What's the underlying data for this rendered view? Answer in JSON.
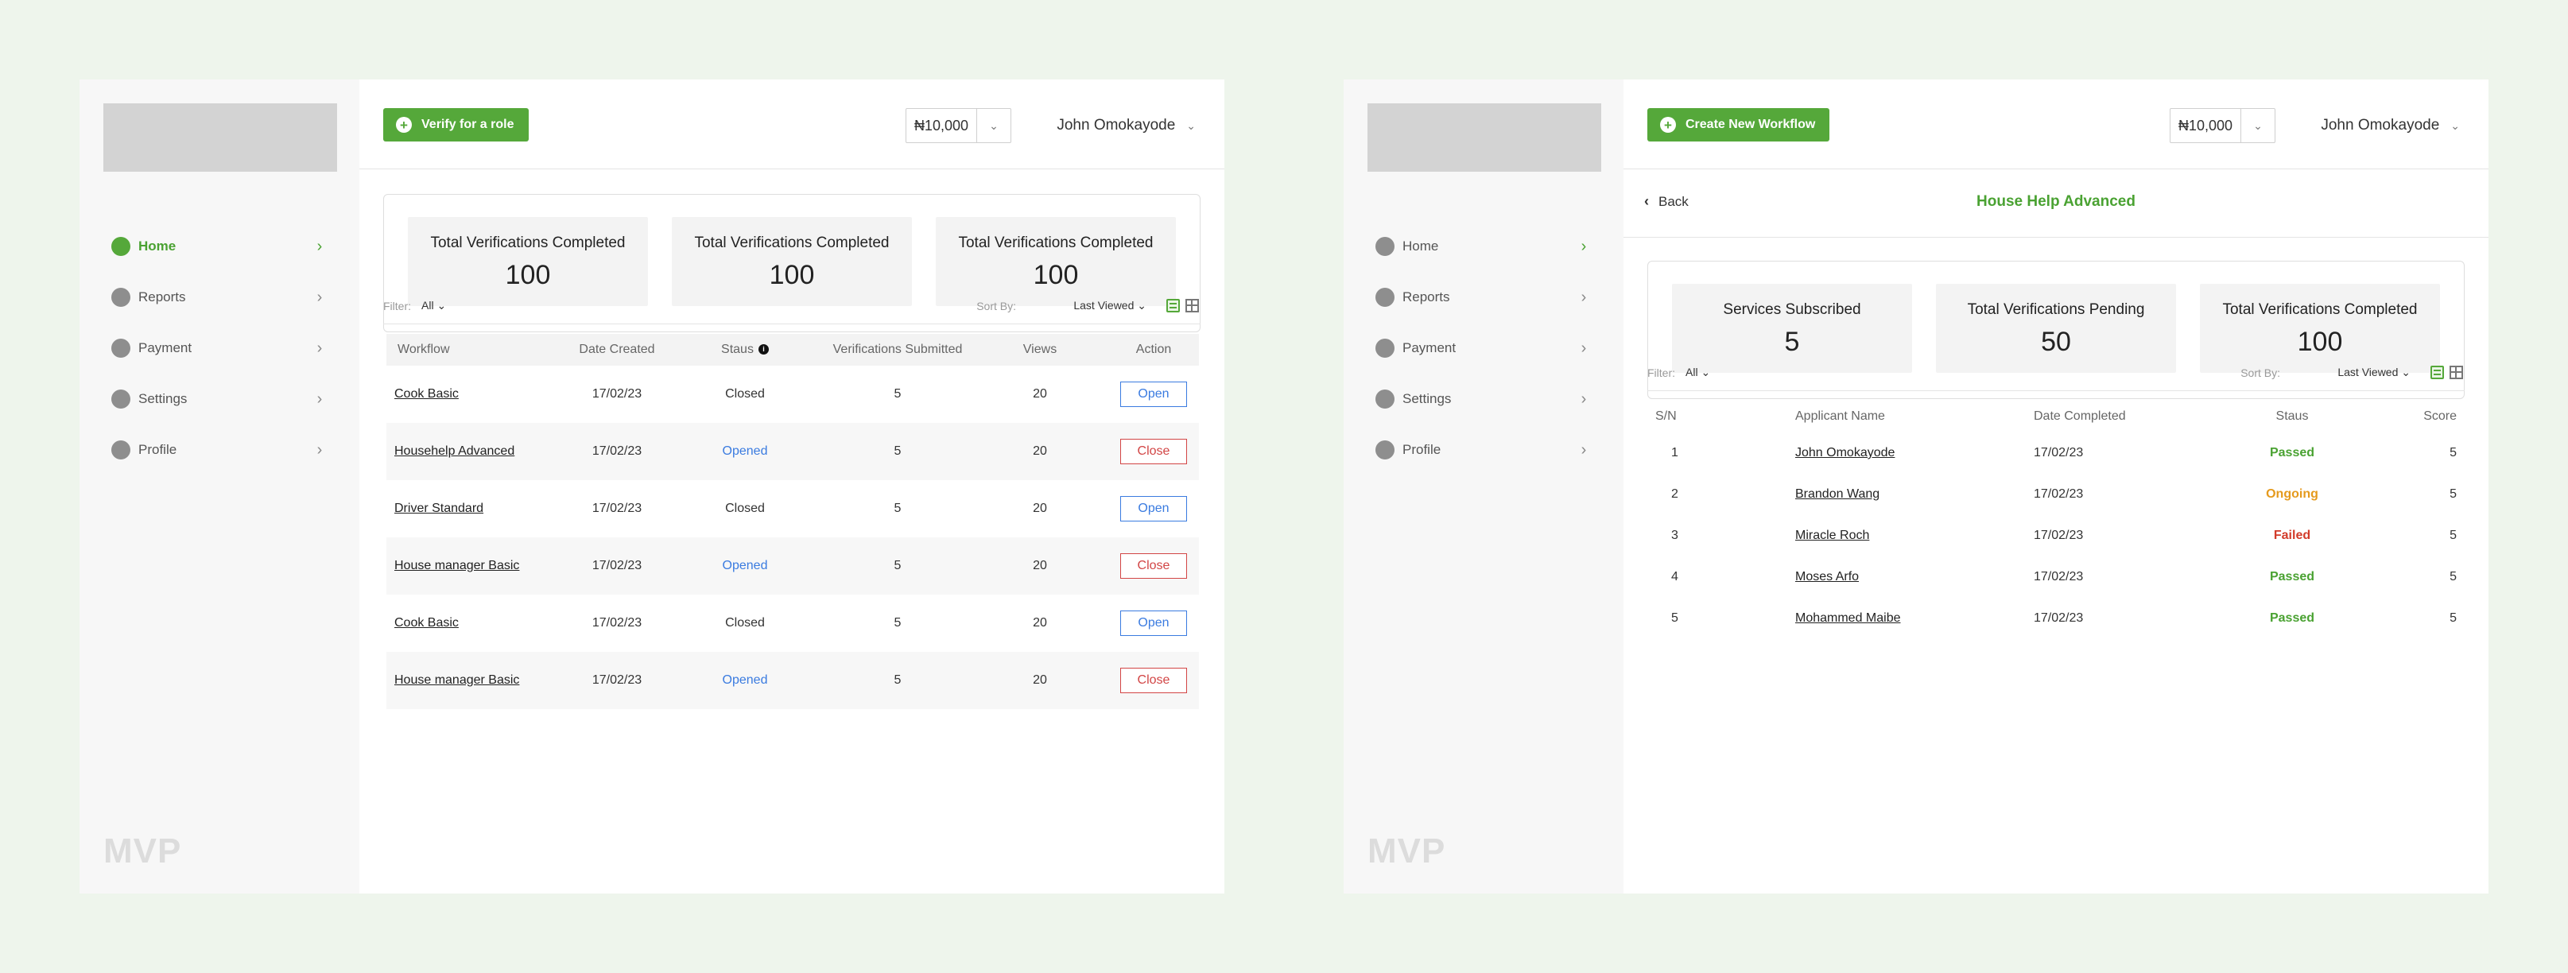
{
  "screen1": {
    "sidebar": {
      "items": [
        {
          "label": "Home",
          "active": true
        },
        {
          "label": "Reports"
        },
        {
          "label": "Payment"
        },
        {
          "label": "Settings"
        },
        {
          "label": "Profile"
        }
      ],
      "watermark": "MVP"
    },
    "topbar": {
      "primary_button": "Verify for a role",
      "balance": "₦10,000",
      "user_name": "John Omokayode"
    },
    "stats": [
      {
        "label": "Total Verifications Completed",
        "value": "100"
      },
      {
        "label": "Total Verifications Completed",
        "value": "100"
      },
      {
        "label": "Total Verifications Completed",
        "value": "100"
      }
    ],
    "filter": {
      "label": "Filter:",
      "value": "All",
      "sort_label": "Sort By:",
      "sort_value": "Last Viewed"
    },
    "table": {
      "headers": [
        "Workflow",
        "Date Created",
        "Staus",
        "Verifications Submitted",
        "Views",
        "Action"
      ],
      "rows": [
        {
          "workflow": "Cook Basic",
          "date": "17/02/23",
          "status": "Closed",
          "submitted": "5",
          "views": "20",
          "action": "Open"
        },
        {
          "workflow": "Househelp Advanced",
          "date": "17/02/23",
          "status": "Opened",
          "submitted": "5",
          "views": "20",
          "action": "Close"
        },
        {
          "workflow": "Driver Standard",
          "date": "17/02/23",
          "status": "Closed",
          "submitted": "5",
          "views": "20",
          "action": "Open"
        },
        {
          "workflow": "House manager Basic",
          "date": "17/02/23",
          "status": "Opened",
          "submitted": "5",
          "views": "20",
          "action": "Close"
        },
        {
          "workflow": "Cook Basic",
          "date": "17/02/23",
          "status": "Closed",
          "submitted": "5",
          "views": "20",
          "action": "Open"
        },
        {
          "workflow": "House manager Basic",
          "date": "17/02/23",
          "status": "Opened",
          "submitted": "5",
          "views": "20",
          "action": "Close"
        }
      ]
    }
  },
  "screen2": {
    "sidebar": {
      "items": [
        {
          "label": "Home",
          "active": false
        },
        {
          "label": "Reports"
        },
        {
          "label": "Payment"
        },
        {
          "label": "Settings"
        },
        {
          "label": "Profile"
        }
      ],
      "watermark": "MVP"
    },
    "topbar": {
      "primary_button": "Create New Workflow",
      "balance": "₦10,000",
      "user_name": "John Omokayode"
    },
    "subheader": {
      "back_label": "Back",
      "title": "House Help Advanced"
    },
    "stats": [
      {
        "label": "Services Subscribed",
        "value": "5"
      },
      {
        "label": "Total Verifications Pending",
        "value": "50"
      },
      {
        "label": "Total Verifications Completed",
        "value": "100"
      }
    ],
    "filter": {
      "label": "Filter:",
      "value": "All",
      "sort_label": "Sort By:",
      "sort_value": "Last Viewed"
    },
    "table": {
      "headers": [
        "S/N",
        "Applicant Name",
        "Date Completed",
        "Staus",
        "Score"
      ],
      "rows": [
        {
          "sn": "1",
          "name": "John Omokayode",
          "date": "17/02/23",
          "status": "Passed",
          "score": "5"
        },
        {
          "sn": "2",
          "name": "Brandon Wang",
          "date": "17/02/23",
          "status": "Ongoing",
          "score": "5"
        },
        {
          "sn": "3",
          "name": "Miracle Roch",
          "date": "17/02/23",
          "status": "Failed",
          "score": "5"
        },
        {
          "sn": "4",
          "name": "Moses Arfo",
          "date": "17/02/23",
          "status": "Passed",
          "score": "5"
        },
        {
          "sn": "5",
          "name": "Mohammed Maibe",
          "date": "17/02/23",
          "status": "Passed",
          "score": "5"
        }
      ]
    }
  },
  "icons": {
    "plus": "plus-circle-icon",
    "chevron": "chevron-right-icon",
    "dropdown": "chevron-down-icon",
    "info": "info-icon",
    "list": "list-view-icon",
    "grid": "grid-view-icon"
  },
  "colors": {
    "brand_green": "#55a83a",
    "link_blue": "#3a7be0",
    "danger_red": "#d24545",
    "warning_orange": "#e59a1d",
    "background": "#eef5ec"
  }
}
